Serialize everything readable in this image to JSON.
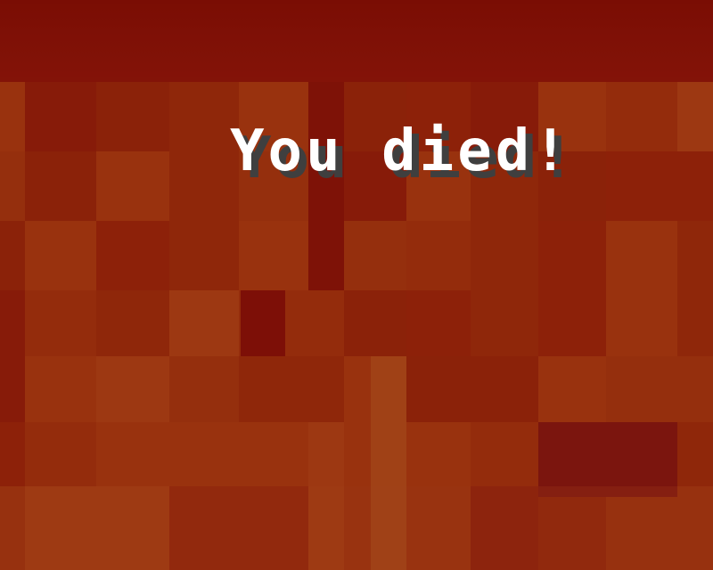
{
  "screen": {
    "title": "You died!"
  },
  "colors": {
    "overlay": "#780000",
    "title_text": "#ffffff",
    "title_shadow": "#3f3f3f",
    "lava_dark": "#8a1c0c",
    "lava_mid": "#9a340f",
    "lava_light": "#a8481a"
  }
}
